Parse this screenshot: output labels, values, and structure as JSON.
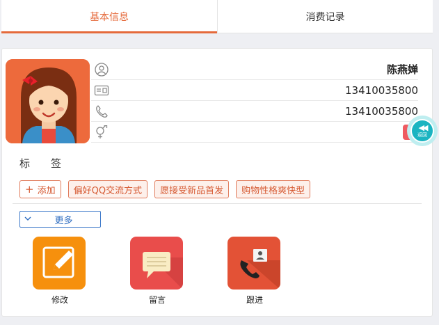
{
  "tabs": [
    {
      "label": "基本信息",
      "active": true
    },
    {
      "label": "消费记录",
      "active": false
    }
  ],
  "profile": {
    "name": "陈燕婵",
    "phone": "13410035800",
    "mobile": "13410035800",
    "gender": ""
  },
  "icons": {
    "person": "person-outline-icon",
    "card": "id-card-icon",
    "phone": "phone-handset-icon",
    "gender": "gender-icon"
  },
  "back_button": {
    "label": "返回"
  },
  "tags_section": {
    "title": "标　　签",
    "add_label": "添加",
    "items": [
      "偏好QQ交流方式",
      "愿接受新品首发",
      "购物性格爽快型"
    ]
  },
  "more_button": {
    "label": "更多"
  },
  "actions": [
    {
      "label": "修改",
      "icon": "edit-pencil-icon"
    },
    {
      "label": "留言",
      "icon": "message-bubble-icon"
    },
    {
      "label": "跟进",
      "icon": "phone-contact-icon"
    }
  ],
  "colors": {
    "accent": "#e56a3b",
    "tag_border": "#e07a5a",
    "link_blue": "#2d6cc0",
    "back_teal": "#1bb4c1"
  }
}
